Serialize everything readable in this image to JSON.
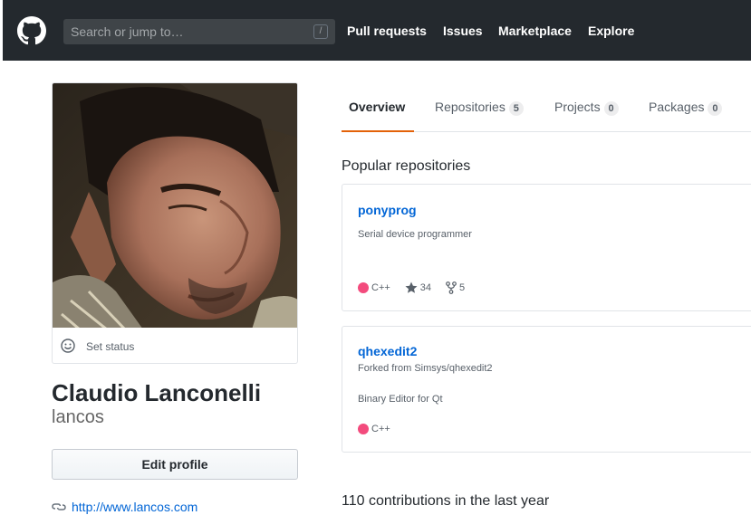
{
  "header": {
    "search_placeholder": "Search or jump to…",
    "search_shortcut": "/",
    "nav": [
      "Pull requests",
      "Issues",
      "Marketplace",
      "Explore"
    ]
  },
  "profile": {
    "status_label": "Set status",
    "full_name": "Claudio Lanconelli",
    "username": "lancos",
    "edit_button": "Edit profile",
    "website": "http://www.lancos.com"
  },
  "tabs": [
    {
      "label": "Overview"
    },
    {
      "label": "Repositories",
      "count": "5"
    },
    {
      "label": "Projects",
      "count": "0"
    },
    {
      "label": "Packages",
      "count": "0"
    }
  ],
  "popular": {
    "title": "Popular repositories",
    "repos": [
      {
        "name": "ponyprog",
        "description": "Serial device programmer",
        "language": "C++",
        "stars": "34",
        "forks": "5"
      },
      {
        "name": "qhexedit2",
        "forked_from": "Forked from Simsys/qhexedit2",
        "description": "Binary Editor for Qt",
        "language": "C++"
      }
    ]
  },
  "contributions": "110 contributions in the last year",
  "colors": {
    "header_bg": "#24292e",
    "link": "#0366d6",
    "tab_accent": "#e36209",
    "cpp_lang": "#f34b7d"
  }
}
